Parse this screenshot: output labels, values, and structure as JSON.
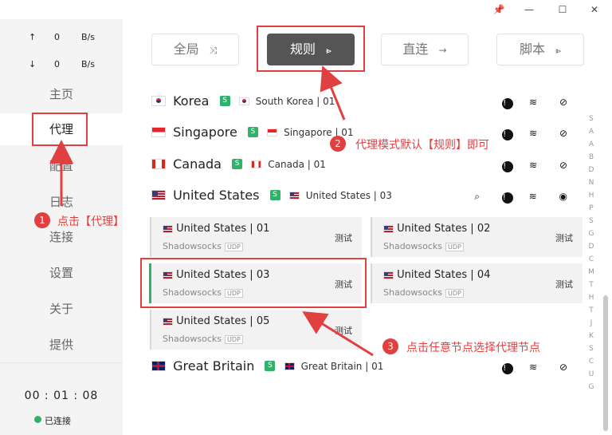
{
  "sidebar": {
    "upload": {
      "arrow": "↑",
      "value": "0",
      "unit": "B/s"
    },
    "download": {
      "arrow": "↓",
      "value": "0",
      "unit": "B/s"
    },
    "nav": [
      "主页",
      "代理",
      "配置",
      "日志",
      "连接",
      "设置",
      "关于",
      "提供"
    ],
    "timer": "00 : 01 : 08",
    "status": "已连接"
  },
  "modes": [
    {
      "label": "全局",
      "icon": "⤨"
    },
    {
      "label": "规则",
      "icon": "⩺"
    },
    {
      "label": "直连",
      "icon": "→"
    },
    {
      "label": "脚本",
      "icon": "⩺"
    }
  ],
  "groups": [
    {
      "name": "Korea",
      "badge": "S",
      "sub": "South Korea | 01"
    },
    {
      "name": "Singapore",
      "badge": "S",
      "sub": "Singapore | 01"
    },
    {
      "name": "Canada",
      "badge": "S",
      "sub": "Canada | 01"
    },
    {
      "name": "United States",
      "badge": "S",
      "sub": "United States | 03"
    },
    {
      "name": "Great Britain",
      "badge": "S",
      "sub": "Great Britain | 01"
    }
  ],
  "nodes": [
    {
      "name": "United States | 01",
      "proto": "Shadowsocks",
      "udp": "UDP",
      "test": "测试"
    },
    {
      "name": "United States | 02",
      "proto": "Shadowsocks",
      "udp": "UDP",
      "test": "测试"
    },
    {
      "name": "United States | 03",
      "proto": "Shadowsocks",
      "udp": "UDP",
      "test": "测试"
    },
    {
      "name": "United States | 04",
      "proto": "Shadowsocks",
      "udp": "UDP",
      "test": "测试"
    },
    {
      "name": "United States | 05",
      "proto": "Shadowsocks",
      "udp": "UDP",
      "test": "测试"
    }
  ],
  "alphabet": [
    "S",
    "A",
    "A",
    "B",
    "D",
    "N",
    "H",
    "P",
    "S",
    "G",
    "D",
    "C",
    "M",
    "T",
    "H",
    "T",
    "J",
    "K",
    "S",
    "C",
    "U",
    "G"
  ],
  "annotations": [
    {
      "num": "1",
      "text": "点击【代理】"
    },
    {
      "num": "2",
      "text": "代理模式默认【规则】即可"
    },
    {
      "num": "3",
      "text": "点击任意节点选择代理节点"
    }
  ],
  "colors": {
    "accent": "#2fb36b",
    "annotation": "#e04040",
    "activeMode": "#555555"
  }
}
